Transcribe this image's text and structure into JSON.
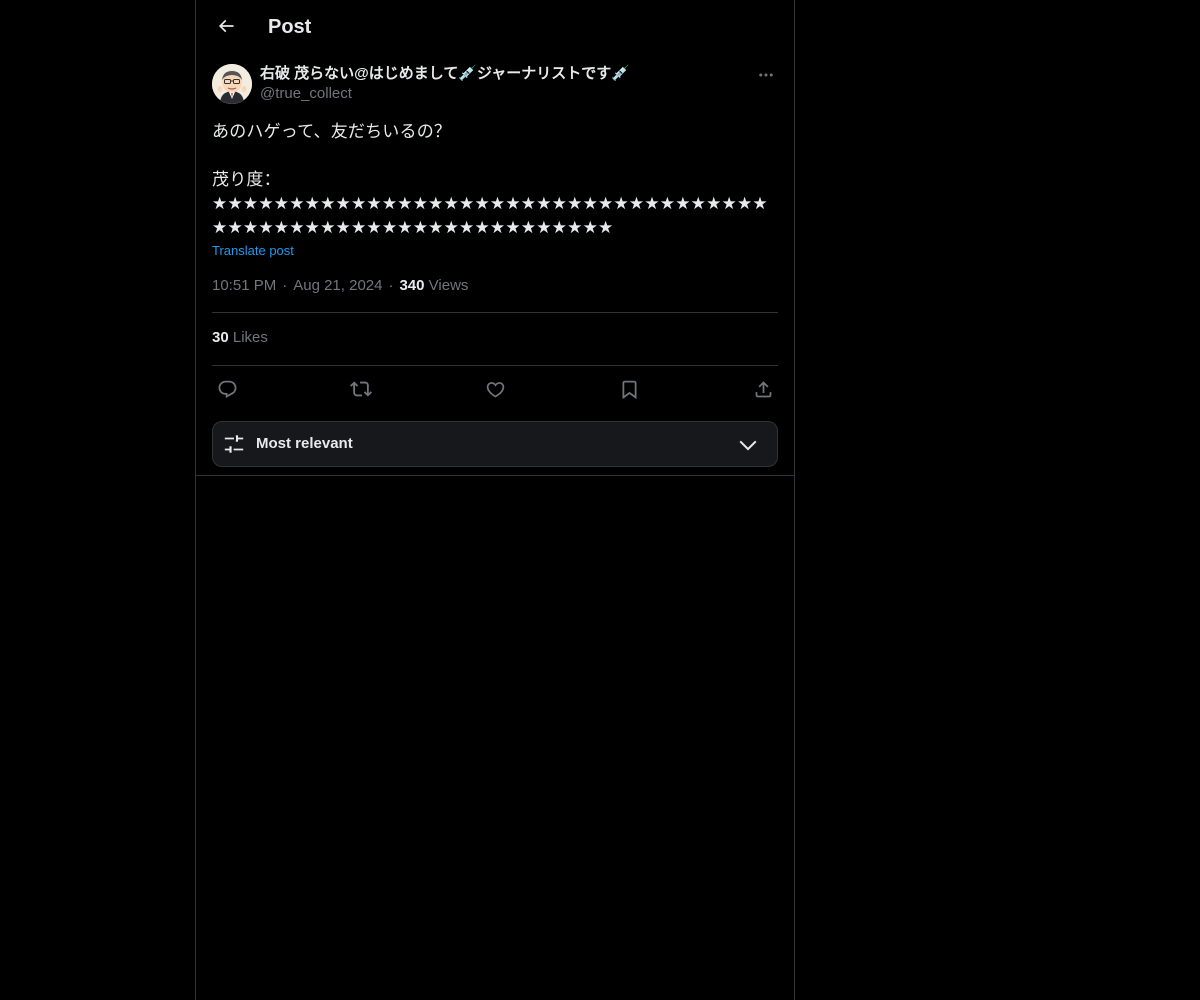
{
  "header": {
    "title": "Post",
    "back_icon": "arrow-left-icon"
  },
  "post": {
    "author": {
      "display_name": "右破 茂らない@はじめまして💉ジャーナリストです💉",
      "handle": "@true_collect",
      "avatar_icon": "avatar"
    },
    "text": "あのハゲって、友だちいるの？\n\n茂り度：\n★★★★★★★★★★★★★★★★★★★★★★★★★★★★★★★★★★★★★★★★★★★★★★★★★★★★★★★★★★★★★★",
    "translate_label": "Translate post",
    "time": "10:51 PM",
    "date": "Aug 21, 2024",
    "separator": "·",
    "views_count": "340",
    "views_label": "Views",
    "likes_count": "30",
    "likes_label": "Likes"
  },
  "actions": {
    "reply_icon": "reply-icon",
    "repost_icon": "repost-icon",
    "like_icon": "heart-icon",
    "bookmark_icon": "bookmark-icon",
    "share_icon": "share-icon"
  },
  "sort": {
    "label": "Most relevant",
    "icon": "sliders-icon",
    "chevron": "chevron-down-icon"
  },
  "colors": {
    "background": "#000000",
    "border": "#2f3336",
    "text_primary": "#e7e9ea",
    "text_secondary": "#71767b",
    "accent": "#1d9bf0"
  }
}
